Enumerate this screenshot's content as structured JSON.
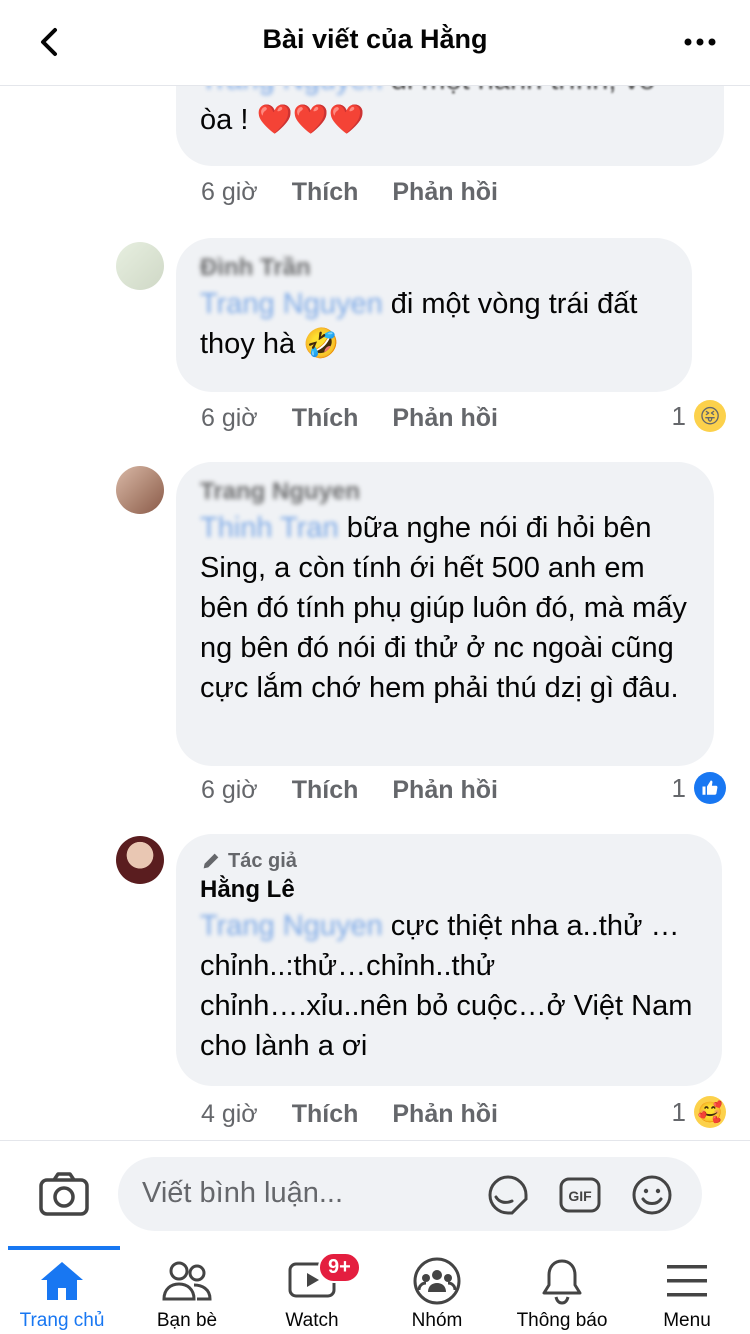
{
  "header": {
    "title": "Bài viết của Hằng"
  },
  "comments": [
    {
      "tag": "Trang Nguyen",
      "text": "đi một hành trình, vỡ òa !",
      "hearts": "❤️❤️❤️",
      "time": "6 giờ",
      "like": "Thích",
      "reply": "Phản hồi"
    },
    {
      "name": "Đình Trần",
      "tag": "Trang Nguyen",
      "text": "đi một vòng trái đất thoy hà",
      "emoji": "🤣",
      "time": "6 giờ",
      "like": "Thích",
      "reply": "Phản hồi",
      "react_count": "1",
      "react_emoji": "😝"
    },
    {
      "name": "Trang Nguyen",
      "tag": "Thinh Tran",
      "text": "bữa nghe nói đi hỏi bên Sing, a còn tính ới hết 500 anh em bên đó tính phụ giúp luôn đó, mà mấy ng bên đó nói đi thử ở nc ngoài cũng cực lắm chớ hem phải thú dzị gì đâu.",
      "time": "6 giờ",
      "like": "Thích",
      "reply": "Phản hồi",
      "react_count": "1"
    },
    {
      "badge": "Tác giả",
      "name": "Hằng Lê",
      "tag": "Trang Nguyen",
      "text": "cực thiệt nha a..thử …chỉnh..:thử…chỉnh..thử chỉnh….xỉu..nên bỏ cuộc…ở Việt Nam cho lành a ơi",
      "time": "4 giờ",
      "like": "Thích",
      "reply": "Phản hồi",
      "react_count": "1",
      "react_emoji": "🥰"
    }
  ],
  "composer": {
    "placeholder": "Viết bình luận..."
  },
  "tabs": [
    {
      "label": "Trang chủ",
      "icon": "home-icon"
    },
    {
      "label": "Bạn bè",
      "icon": "friends-icon"
    },
    {
      "label": "Watch",
      "icon": "watch-icon",
      "badge": "9+"
    },
    {
      "label": "Nhóm",
      "icon": "groups-icon"
    },
    {
      "label": "Thông báo",
      "icon": "bell-icon"
    },
    {
      "label": "Menu",
      "icon": "menu-icon"
    }
  ],
  "colors": {
    "accent": "#1877f2",
    "bubble": "#f0f2f5",
    "secondary_text": "#65676b",
    "badge": "#e41e3f"
  }
}
